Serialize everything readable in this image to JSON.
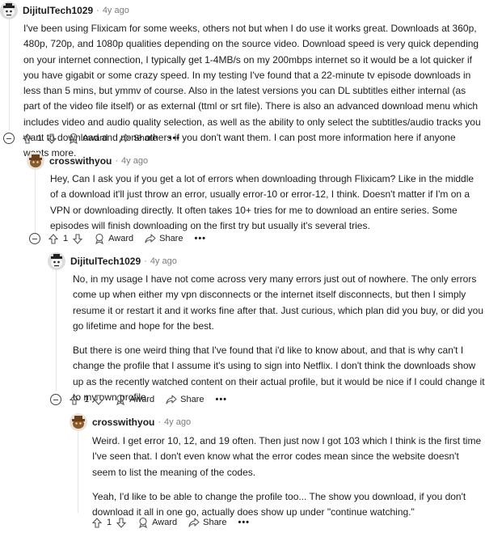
{
  "comments": [
    {
      "author": "DijitulTech1029",
      "time": "4y ago",
      "avatar": "snoo-dark-avatar",
      "paragraphs": [
        "I've been using Flixicam for some weeks, others not but when I do use it works great. Downloads at 360p, 480p, 720p, and 1080p qualities depending on the source video. Download speed is very quick depending on your internet connection, I typically get 1-4MB/s on my 200mbps internet so it would be a lot quicker if you have gigabit or some crazy speed. In my testing I've found that a 22-minute tv episode downloads in less than 5 mins, but ymmv of course. Also in the latest versions you can DL subtitles either internal (as part of the video file itself) or as external (ttml or srt file). There is also an advanced download menu which includes video and audio quality selection, as well as the ability to only select the subtitles/audio tracks you want to download and none others if you don't want them. I can post more information here if anyone wants more."
      ],
      "votes": "1"
    },
    {
      "author": "crosswithyou",
      "time": "4y ago",
      "avatar": "snoo-brown-avatar",
      "paragraphs": [
        "Hey, Can I ask you if you get a lot of errors when downloading through Flixicam? Like in the middle of a download it'll just throw an error, usually error-10 or error-12, I think. Doesn't matter if I'm on a VPN or downloading directly. It often takes 10+ tries for me to download an entire series. Some episodes will finish downloading on the first try but usually it's several tries."
      ],
      "votes": "1"
    },
    {
      "author": "DijitulTech1029",
      "time": "4y ago",
      "avatar": "snoo-dark-avatar",
      "paragraphs": [
        "No, in my usage I have not come across very many errors just out of nowhere. The only errors come up when either my vpn disconnects or the internet itself disconnects, but then I simply resume it or restart it and it works fine after that. Just curious, which plan did you buy, or did you go lifetime and hope for the best.",
        "But there is one weird thing that I've found that i'd like to know about, and that is why can't I change the profile that I assume it's using to sign into Netflix. I don't think the downloads show up as the recently watched content on their actual profile, but it would be nice if I could change it to my own profile."
      ],
      "votes": "1"
    },
    {
      "author": "crosswithyou",
      "time": "4y ago",
      "avatar": "snoo-brown-avatar",
      "paragraphs": [
        "Weird. I get error 10, 12, and 19 often. Then just now I got 103 which I think is the first time I've seen that. I don't even know what the error codes mean since the website doesn't seem to list the meaning of the codes.",
        "Yeah, I'd like to be able to change the profile too... The show you download, if you don't download it all in one go, actually does show up under \"continue watching.\""
      ],
      "votes": "1"
    }
  ],
  "labels": {
    "separator": "·",
    "award": "Award",
    "share": "Share",
    "more": "•••"
  }
}
